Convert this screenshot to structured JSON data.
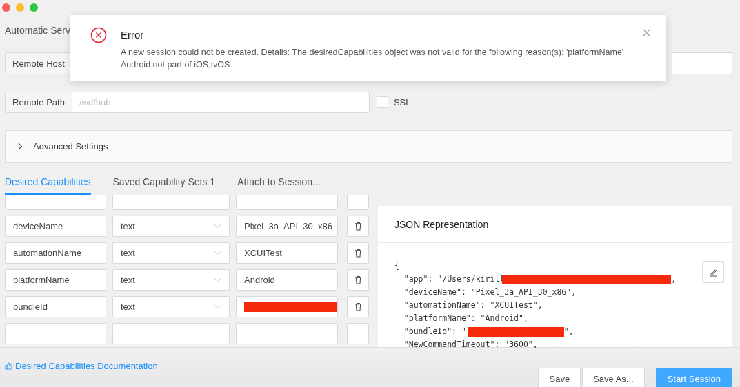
{
  "window": {
    "title": "Automatic Serv"
  },
  "remote_host": {
    "label": "Remote Host"
  },
  "remote_path": {
    "label": "Remote Path",
    "placeholder": "/wd/hub"
  },
  "ssl": {
    "label": "SSL",
    "checked": false
  },
  "advanced_settings": {
    "label": "Advanced Settings",
    "expanded": false
  },
  "tabs": [
    {
      "label": "Desired Capabilities",
      "selected": true
    },
    {
      "label": "Saved Capability Sets 1",
      "selected": false
    },
    {
      "label": "Attach to Session...",
      "selected": false
    }
  ],
  "capabilities": [
    {
      "name": "deviceName",
      "type": "text",
      "value": "Pixel_3a_API_30_x86",
      "redacted": false
    },
    {
      "name": "automationName",
      "type": "text",
      "value": "XCUITest",
      "redacted": false
    },
    {
      "name": "platformName",
      "type": "text",
      "value": "Android",
      "redacted": false
    },
    {
      "name": "bundleId",
      "type": "text",
      "redacted": true
    }
  ],
  "json_panel": {
    "title": "JSON Representation",
    "lines": [
      {
        "text": "{",
        "redacted": false
      },
      {
        "text": "  \"app\": \"/Users/kirill",
        "redacted": true,
        "after": ","
      },
      {
        "text": "  \"deviceName\": \"Pixel_3a_API_30_x86\",",
        "redacted": false
      },
      {
        "text": "  \"automationName\": \"XCUITest\",",
        "redacted": false
      },
      {
        "text": "  \"platformName\": \"Android\",",
        "redacted": false
      },
      {
        "text": "  \"bundleId\": \"",
        "redacted": true,
        "after": "\","
      },
      {
        "text": "  \"NewCommandTimeout\": \"3600\",",
        "redacted": false
      }
    ]
  },
  "footer": {
    "link": "Desired Capabilities Documentation",
    "buttons": [
      {
        "label": "Save",
        "kind": "default"
      },
      {
        "label": "Save As...",
        "kind": "default"
      },
      {
        "label": "Start Session",
        "kind": "primary"
      }
    ]
  },
  "error_dialog": {
    "title": "Error",
    "message": "A new session could not be created. Details: The desiredCapabilities object was not valid for the following reason(s): 'platformName' Android not part of iOS,tvOS"
  }
}
